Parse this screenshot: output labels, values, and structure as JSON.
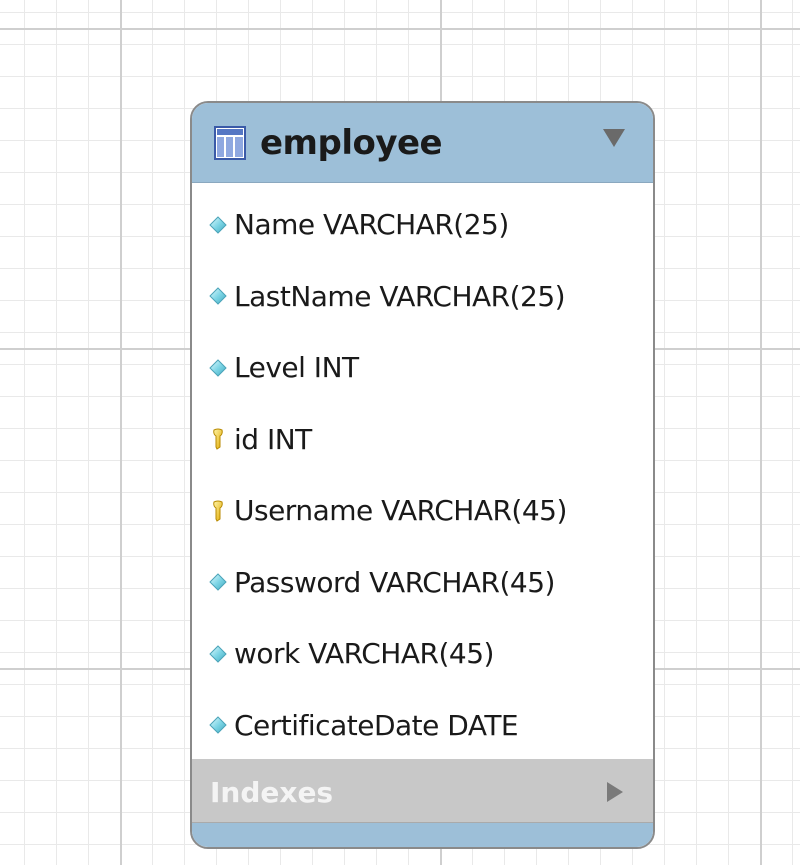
{
  "table": {
    "name": "employee",
    "columns": [
      {
        "label": "Name VARCHAR(25)",
        "icon": "diamond-icon"
      },
      {
        "label": "LastName VARCHAR(25)",
        "icon": "diamond-icon"
      },
      {
        "label": "Level INT",
        "icon": "diamond-icon"
      },
      {
        "label": "id INT",
        "icon": "key-icon"
      },
      {
        "label": "Username VARCHAR(45)",
        "icon": "key-icon"
      },
      {
        "label": "Password VARCHAR(45)",
        "icon": "diamond-icon"
      },
      {
        "label": "work VARCHAR(45)",
        "icon": "diamond-icon"
      },
      {
        "label": "CertificateDate DATE",
        "icon": "diamond-icon"
      }
    ],
    "indexes_label": "Indexes"
  },
  "colors": {
    "header": "#9dbfd8",
    "indexes_bar": "#c8c8c8",
    "column_icon": "#7fd6e6",
    "key_icon": "#f2c400"
  }
}
